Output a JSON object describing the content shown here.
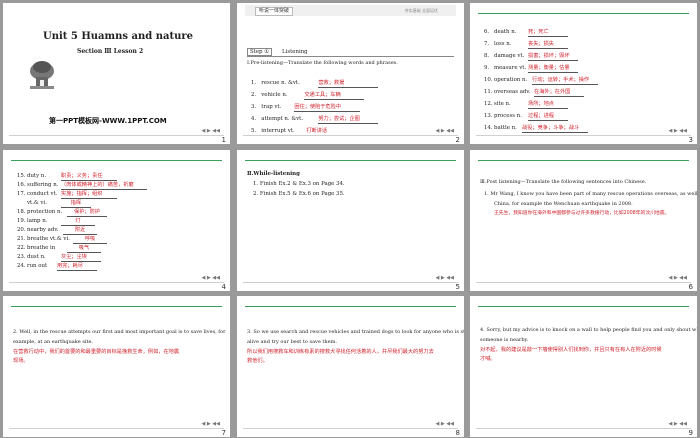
{
  "slide1": {
    "title": "Unit 5   Huamns and nature",
    "section": "Section Ⅲ   Lesson 2",
    "logo_caption": "ATIVA",
    "site": "第一PPT模板网-WWW.1PPT.COM",
    "number": "1"
  },
  "slide2": {
    "header_box": "听说一体突破",
    "header_right": "夯实基础  全面培优",
    "step_label": "Step ①",
    "step_title": "Listening",
    "heading": "Ⅰ.Pre-listening—Translate the following words and phrases.",
    "items": [
      {
        "n": "1.",
        "en": "rescue n.   &vt.",
        "cn": "营救；救援"
      },
      {
        "n": "2.",
        "en": "vehicle n.",
        "cn": "交通工具；车辆"
      },
      {
        "n": "3.",
        "en": "trap vt.",
        "cn": "困住；使陷于危险中"
      },
      {
        "n": "4.",
        "en": "attempt n.   &vt.",
        "cn": "努力；尝试；企图"
      },
      {
        "n": "5.",
        "en": "interrupt vt.",
        "cn": "打断讲话"
      }
    ],
    "number": "2"
  },
  "slide3": {
    "items": [
      {
        "n": "6.",
        "en": "death n.",
        "cn": "死；死亡"
      },
      {
        "n": "7.",
        "en": "loss n.",
        "cn": "丧失；损失"
      },
      {
        "n": "8.",
        "en": "damage vt.",
        "cn": "损害；损坏；毁坏"
      },
      {
        "n": "9.",
        "en": "measure vt.",
        "cn": "测量；衡量；估量"
      },
      {
        "n": "10.",
        "en": "operation n.",
        "cn": "行动；运转；手术；操作"
      },
      {
        "n": "11.",
        "en": "overseas adv.",
        "cn": "在海外；在外国"
      },
      {
        "n": "12.",
        "en": "site n.",
        "cn": "场所；地点"
      },
      {
        "n": "13.",
        "en": "process n.",
        "cn": "过程；进程"
      },
      {
        "n": "14.",
        "en": "battle n.",
        "cn": "战役；竞争；斗争；战斗"
      }
    ],
    "number": "3"
  },
  "slide4": {
    "items": [
      {
        "n": "15.",
        "en": "duty n.",
        "cn": "职责；义务；责任"
      },
      {
        "n": "16.",
        "en": "suffering n.",
        "cn": "（肉体或精神上的）痛苦，折磨"
      },
      {
        "n": "17.",
        "en": "conduct vt.",
        "cn": "实施；指挥；组织"
      },
      {
        "n": "",
        "en": "vt.& vi.",
        "cn": "指挥"
      },
      {
        "n": "18.",
        "en": "protection n.",
        "cn": "保护；防护"
      },
      {
        "n": "19.",
        "en": "lamp n.",
        "cn": "灯"
      },
      {
        "n": "20.",
        "en": "nearby adv.",
        "cn": "附近"
      },
      {
        "n": "21.",
        "en": "breathe vt.& vi.",
        "cn": "呼吸"
      },
      {
        "n": "22.",
        "en": "breathe in",
        "cn": "吸气"
      },
      {
        "n": "23.",
        "en": "dust n.",
        "cn": "灰尘；尘埃"
      },
      {
        "n": "24.",
        "en": "run out",
        "cn": "用完；耗尽"
      }
    ],
    "number": "4"
  },
  "slide5": {
    "heading": "Ⅱ.While-listening",
    "items": [
      {
        "n": "1.",
        "en": "Finish Ex.2 & Ex.3 on Page 34."
      },
      {
        "n": "2.",
        "en": "Finish Ex.5 & Ex.6 on Page 35."
      }
    ],
    "number": "5"
  },
  "slide6": {
    "heading": "Ⅲ.Post listening—Translate the following sentences into Chinese.",
    "en_lines": [
      "1.   Mr Wang, I know you have been part of many rescue operations overseas, as well as in",
      "China, for example the Wenchuan earthquake in 2008."
    ],
    "cn": "王先生，我知道你在海外和中国都参与过许多救援行动，比如2008年的汶川地震。",
    "number": "6"
  },
  "slide7": {
    "en_lines": [
      "2.   Well, in the rescue attempts our first and most important goal is to save lives, for",
      "example, at an earthquake site."
    ],
    "cn_lines": [
      "在营救行动中，我们的首要的和最重要的目标是挽救生命，例如，在地震",
      "现场。"
    ],
    "number": "7"
  },
  "slide8": {
    "en_lines": [
      "3.   So we use search and rescue vehicles and trained dogs to look for anyone who is still",
      "alive and try our best to save them."
    ],
    "cn_lines": [
      "所以我们用搜救车和训练有素的搜救犬寻找任何活着的人，并尽我们最大的努力去",
      "救他们。"
    ],
    "number": "8"
  },
  "slide9": {
    "en_lines": [
      "4.   Sorry, but my advice is to knock on a wall to help people find you and only shout when",
      "someone is nearby."
    ],
    "cn_lines": [
      "对不起，我的建议是敲一下墙使得别人们找到你，并且只有在有人在附近的时候",
      "才喊。"
    ],
    "number": "9"
  },
  "nav_label": "◀ ▶ ◀◀"
}
